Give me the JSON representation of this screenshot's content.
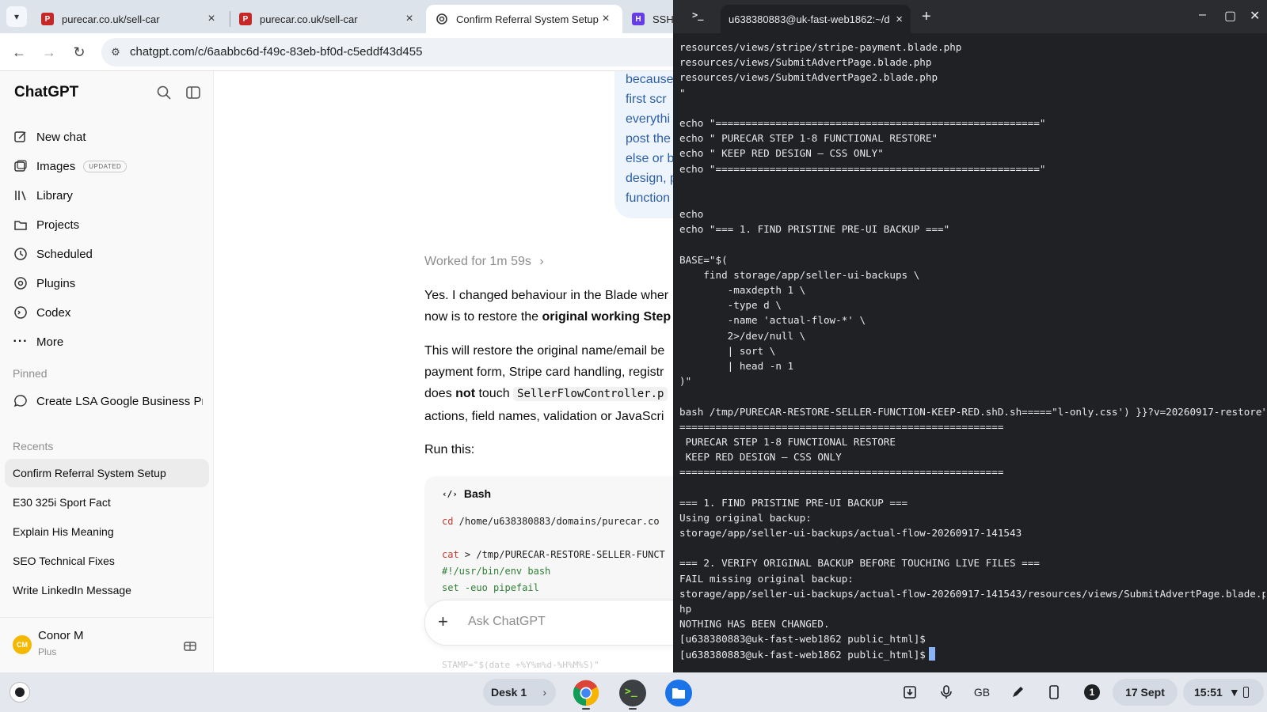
{
  "browser": {
    "tabs": [
      {
        "title": "purecar.co.uk/sell-car",
        "favicon": "purecar-favicon"
      },
      {
        "title": "purecar.co.uk/sell-car",
        "favicon": "purecar-favicon"
      },
      {
        "title": "Confirm Referral System Setup",
        "favicon": "chatgpt-favicon",
        "active": true
      },
      {
        "title": "SSH",
        "favicon": "hostinger-favicon"
      }
    ],
    "url": "chatgpt.com/c/6aabbc6d-f49c-83eb-bf0d-c5eddf43d455"
  },
  "sidebar": {
    "brand": "ChatGPT",
    "nav": [
      {
        "label": "New chat",
        "icon": "edit-icon"
      },
      {
        "label": "Images",
        "icon": "images-icon",
        "badge": "UPDATED"
      },
      {
        "label": "Library",
        "icon": "library-icon"
      },
      {
        "label": "Projects",
        "icon": "folder-icon"
      },
      {
        "label": "Scheduled",
        "icon": "clock-icon"
      },
      {
        "label": "Plugins",
        "icon": "plugins-icon"
      },
      {
        "label": "Codex",
        "icon": "codex-icon"
      },
      {
        "label": "More",
        "icon": "more-icon"
      }
    ],
    "pinned_label": "Pinned",
    "pinned": [
      {
        "label": "Create LSA Google Business Pro"
      }
    ],
    "recents_label": "Recents",
    "recents": [
      {
        "label": "Confirm Referral System Setup",
        "active": true
      },
      {
        "label": "E30 325i Sport Fact"
      },
      {
        "label": "Explain His Meaning"
      },
      {
        "label": "SEO Technical Fixes"
      },
      {
        "label": "Write LinkedIn Message"
      }
    ],
    "user": {
      "initials": "CM",
      "name": "Conor M",
      "plan": "Plus"
    }
  },
  "chat": {
    "user_bubble_lines": [
      "because",
      "first scr",
      "everythi",
      "post the",
      "else or b",
      "design, p",
      "function"
    ],
    "worked_label": "Worked for 1m 59s",
    "para1_line1": "Yes. I changed behaviour in the Blade wher",
    "para1_line2_pre": "now is to restore the ",
    "para1_line2_bold": "original working Step",
    "para2_line1": "This will restore the original name/email be",
    "para2_line2": "payment form, Stripe card handling, registr",
    "para2_line3_pre": "does ",
    "para2_line3_bold": "not",
    "para2_line3_mid": " touch ",
    "para2_line3_code": "SellerFlowController.p",
    "para2_line4": "actions, field names, validation or JavaScri",
    "run_this": "Run this:",
    "code_lang": "Bash",
    "code": {
      "l1_cmd": "cd",
      "l1_arg": " /home/u638380883/domains/purecar.co",
      "l2_cmd": "cat",
      "l2_arg": " > /tmp/PURECAR-RESTORE-SELLER-FUNCT",
      "l3": "#!/usr/bin/env bash",
      "l4": "set -euo pipefail"
    },
    "composer_placeholder": "Ask ChatGPT",
    "ghost_line": "STAMP=\"$(date +%Y%m%d-%H%M%S)\""
  },
  "terminal": {
    "tab_title": "u638380883@uk-fast-web1862:~/d",
    "lines": [
      "resources/views/stripe/stripe-payment.blade.php",
      "resources/views/SubmitAdvertPage.blade.php",
      "resources/views/SubmitAdvertPage2.blade.php",
      "\"",
      "",
      "echo \"======================================================\"",
      "echo \" PURECAR STEP 1-8 FUNCTIONAL RESTORE\"",
      "echo \" KEEP RED DESIGN — CSS ONLY\"",
      "echo \"======================================================\"",
      "",
      "",
      "echo",
      "echo \"=== 1. FIND PRISTINE PRE-UI BACKUP ===\"",
      "",
      "BASE=\"$(",
      "    find storage/app/seller-ui-backups \\",
      "        -maxdepth 1 \\",
      "        -type d \\",
      "        -name 'actual-flow-*' \\",
      "        2>/dev/null \\",
      "        | sort \\",
      "        | head -n 1",
      ")\"",
      "",
      "bash /tmp/PURECAR-RESTORE-SELLER-FUNCTION-KEEP-RED.shD.sh=====\"l-only.css') }}?v=20260917-restore\"",
      "======================================================",
      " PURECAR STEP 1-8 FUNCTIONAL RESTORE",
      " KEEP RED DESIGN — CSS ONLY",
      "======================================================",
      "",
      "=== 1. FIND PRISTINE PRE-UI BACKUP ===",
      "Using original backup:",
      "storage/app/seller-ui-backups/actual-flow-20260917-141543",
      "",
      "=== 2. VERIFY ORIGINAL BACKUP BEFORE TOUCHING LIVE FILES ===",
      "FAIL missing original backup:",
      "storage/app/seller-ui-backups/actual-flow-20260917-141543/resources/views/SubmitAdvertPage.blade.p",
      "hp",
      "NOTHING HAS BEEN CHANGED.",
      "[u638380883@uk-fast-web1862 public_html]$",
      "[u638380883@uk-fast-web1862 public_html]$"
    ]
  },
  "shelf": {
    "desk_label": "Desk 1",
    "input_method": "GB",
    "notification_count": "1",
    "date": "17 Sept",
    "time": "15:51"
  },
  "colors": {
    "terminal_bg": "#202124",
    "sidebar_bg": "#f9f9f9",
    "shelf_bg": "#e4e8ee",
    "chrome_tabstrip": "#dde3ea",
    "cursor": "#8ab4f8",
    "code_keyword": "#c0392b",
    "code_comment": "#2e7d32",
    "bubble_text": "#2c5ea8"
  }
}
